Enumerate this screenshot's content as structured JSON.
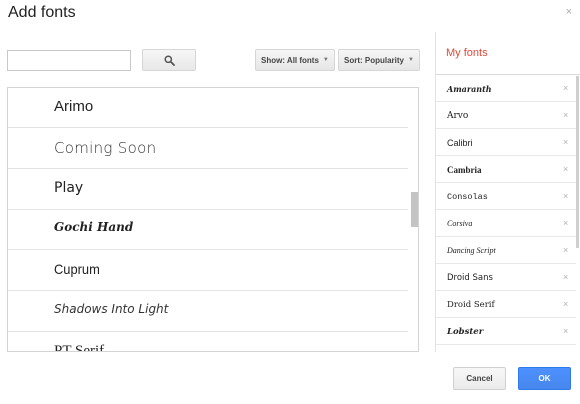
{
  "dialog": {
    "title": "Add fonts",
    "close_glyph": "×"
  },
  "search": {
    "value": "",
    "placeholder": "",
    "button_icon": "search-icon"
  },
  "filters": {
    "show_label": "Show: All fonts",
    "sort_label": "Sort: Popularity"
  },
  "font_list": [
    {
      "name": "Arimo"
    },
    {
      "name": "Coming Soon"
    },
    {
      "name": "Play"
    },
    {
      "name": "Gochi Hand"
    },
    {
      "name": "Cuprum"
    },
    {
      "name": "Shadows Into Light"
    },
    {
      "name": "PT Serif"
    }
  ],
  "my_fonts": {
    "title": "My fonts",
    "items": [
      {
        "name": "Amaranth"
      },
      {
        "name": "Arvo"
      },
      {
        "name": "Calibri"
      },
      {
        "name": "Cambria"
      },
      {
        "name": "Consolas"
      },
      {
        "name": "Corsiva"
      },
      {
        "name": "Dancing Script"
      },
      {
        "name": "Droid Sans"
      },
      {
        "name": "Droid Serif"
      },
      {
        "name": "Lobster"
      }
    ],
    "remove_glyph": "×"
  },
  "actions": {
    "cancel_label": "Cancel",
    "ok_label": "OK"
  },
  "colors": {
    "accent_red": "#dd4b39",
    "primary_blue": "#4d90fe"
  }
}
